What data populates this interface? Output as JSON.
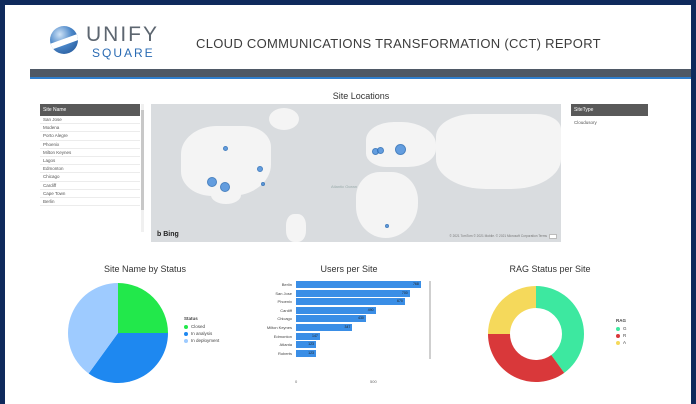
{
  "header": {
    "logo_word": "UNIFY",
    "logo_sub": "SQUARE",
    "report_title": "CLOUD COMMUNICATIONS TRANSFORMATION (CCT) REPORT"
  },
  "map_section": {
    "title": "Site Locations",
    "site_name_slicer": {
      "header": "Site Name",
      "items": [
        "San Jose",
        "Modena",
        "Porto Alegre",
        "Phoenix",
        "Milton Keynes",
        "Lagos",
        "Edmonton",
        "Chicago",
        "Cardiff",
        "Cape Town",
        "Berlin"
      ]
    },
    "site_type_slicer": {
      "header": "SiteType",
      "items": [
        "Cloudusory"
      ]
    },
    "map_brand": "b Bing",
    "map_credit": "© 2021 TomTom © 2021 Mobile. © 2021 Microsoft Corporation   Terms",
    "ocean_label": "Atlantic\nOcean"
  },
  "status_chart": {
    "title": "Site Name by Status",
    "legend_title": "Status",
    "legend": [
      {
        "label": "Closed",
        "color": "#22e84b"
      },
      {
        "label": "In analysis",
        "color": "#1e88f0"
      },
      {
        "label": "In deployment",
        "color": "#9ecbff"
      }
    ]
  },
  "users_chart": {
    "title": "Users per Site",
    "axis_ticks": [
      "0",
      "500"
    ]
  },
  "rag_chart": {
    "title": "RAG Status per Site",
    "legend_title": "RAG",
    "legend": [
      {
        "label": "G",
        "color": "#3de8a0"
      },
      {
        "label": "R",
        "color": "#d9383a"
      },
      {
        "label": "A",
        "color": "#f5d95b"
      }
    ]
  },
  "chart_data": [
    {
      "type": "pie",
      "title": "Site Name by Status",
      "categories": [
        "Closed",
        "In analysis",
        "In deployment"
      ],
      "values": [
        25,
        35,
        40
      ],
      "colors": [
        "#22e84b",
        "#1e88f0",
        "#9ecbff"
      ],
      "legend_position": "right"
    },
    {
      "type": "bar",
      "orientation": "horizontal",
      "title": "Users per Site",
      "categories": [
        "Berlin",
        "San Jose",
        "Phoenix",
        "Cardiff",
        "Chicago",
        "Milton Keynes",
        "Edmonton",
        "Atlanta",
        "Roberts"
      ],
      "values": [
        768,
        700,
        670,
        490,
        430,
        347,
        147,
        123,
        123
      ],
      "xlim": [
        0,
        800
      ],
      "color": "#3a8ee6"
    },
    {
      "type": "pie",
      "subtype": "donut",
      "title": "RAG Status per Site",
      "categories": [
        "G",
        "R",
        "A"
      ],
      "values": [
        40,
        35,
        25
      ],
      "colors": [
        "#3de8a0",
        "#d9383a",
        "#f5d95b"
      ],
      "legend_position": "right"
    }
  ]
}
